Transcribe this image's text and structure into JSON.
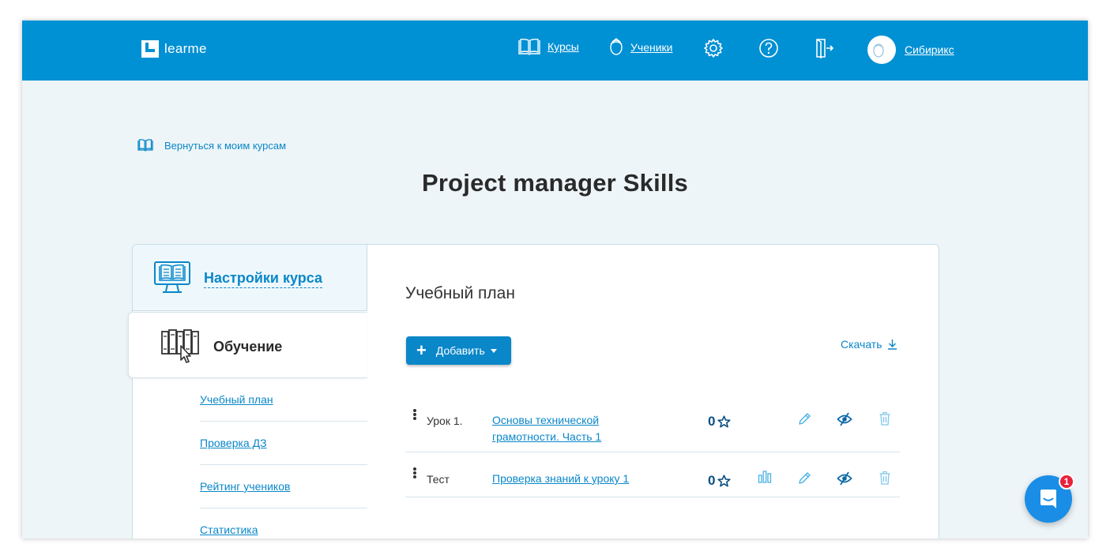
{
  "header": {
    "logo_text": "learme",
    "nav": {
      "courses": "Курсы",
      "students": "Ученики",
      "user_name": "Сибирикс"
    }
  },
  "back_link": "Вернуться к моим курсам",
  "page_title": "Project manager Skills",
  "sidebar": {
    "settings": "Настройки курса",
    "learning": "Обучение",
    "items": [
      {
        "label": "Учебный план"
      },
      {
        "label": "Проверка ДЗ"
      },
      {
        "label": "Рейтинг учеников"
      },
      {
        "label": "Статистика"
      }
    ]
  },
  "main": {
    "title": "Учебный план",
    "add_button": "Добавить",
    "download": "Скачать",
    "rows": [
      {
        "kind": "Урок 1.",
        "title": "Основы технической грамотности. Часть 1",
        "stars": "0"
      },
      {
        "kind": "Тест",
        "title": "Проверка знаний к уроку 1",
        "stars": "0"
      }
    ]
  },
  "chat": {
    "badge": "1"
  },
  "colors": {
    "brand": "#0090d4",
    "link": "#0a87c9",
    "badge": "#e8213a"
  },
  "icons": [
    "book-icon",
    "student-icon",
    "gear-icon",
    "help-icon",
    "logout-icon",
    "avatar-icon",
    "open-book-icon",
    "monitor-book-icon",
    "library-pointer-icon",
    "plus-icon",
    "download-icon",
    "drag-handle-icon",
    "star-icon",
    "chart-icon",
    "pencil-icon",
    "eye-icon",
    "trash-icon",
    "chat-icon"
  ]
}
